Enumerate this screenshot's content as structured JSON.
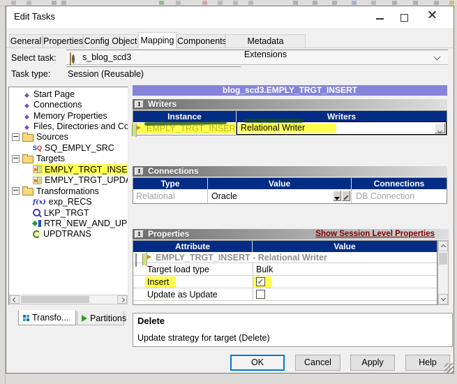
{
  "window": {
    "title": "Edit Tasks"
  },
  "tabs": {
    "active": "Mapping",
    "items": [
      {
        "label": "General"
      },
      {
        "label": "Properties"
      },
      {
        "label": "Config Object"
      },
      {
        "label": "Mapping"
      },
      {
        "label": "Components"
      },
      {
        "label": "Metadata Extensions"
      }
    ]
  },
  "task_form": {
    "select_task_label": "Select task:",
    "select_task_value": "s_blog_scd3",
    "task_type_label": "Task type:",
    "task_type_value": "Session (Reusable)"
  },
  "tree": {
    "items": [
      {
        "label": "Start Page",
        "icon": "navigation-diamond-icon"
      },
      {
        "label": "Connections",
        "icon": "navigation-diamond-icon"
      },
      {
        "label": "Memory Properties",
        "icon": "navigation-diamond-icon"
      },
      {
        "label": "Files, Directories and Com",
        "icon": "navigation-diamond-icon"
      },
      {
        "label": "Sources",
        "icon": "folder-icon",
        "expanded": true
      },
      {
        "label": "SQ_EMPLY_SRC",
        "icon": "source-qualifier-icon"
      },
      {
        "label": "Targets",
        "icon": "folder-icon",
        "expanded": true
      },
      {
        "label": "EMPLY_TRGT_INSERT",
        "icon": "target-icon",
        "highlighted": true
      },
      {
        "label": "EMPLY_TRGT_UPDATI",
        "icon": "target-icon"
      },
      {
        "label": "Transformations",
        "icon": "folder-icon",
        "expanded": true
      },
      {
        "label": "exp_RECS",
        "icon": "expression-icon"
      },
      {
        "label": "LKP_TRGT",
        "icon": "lookup-icon"
      },
      {
        "label": "RTR_NEW_AND_UPD.",
        "icon": "router-icon"
      },
      {
        "label": "UPDTRANS",
        "icon": "update-strategy-icon"
      }
    ]
  },
  "main": {
    "title": "blog_scd3.EMPLY_TRGT_INSERT",
    "writers": {
      "label": "Writers",
      "columns": [
        "Instance",
        "Writers"
      ],
      "row": {
        "instance": "EMPLY_TRGT_INSERT",
        "writer": "Relational Writer"
      }
    },
    "connections": {
      "label": "Connections",
      "columns": [
        "Type",
        "Value",
        "Connections"
      ],
      "row": {
        "type": "Relational",
        "value": "Oracle",
        "connection": "DB Connection"
      }
    },
    "properties": {
      "label": "Properties",
      "link": "Show Session Level Properties",
      "columns": [
        "Attribute",
        "Value"
      ],
      "group": "EMPLY_TRGT_INSERT - Relational Writer",
      "rows": [
        {
          "attribute": "Target load type",
          "value": "Bulk"
        },
        {
          "attribute": "Insert",
          "check": "✓",
          "highlighted": true
        },
        {
          "attribute": "Update as Update",
          "check": ""
        }
      ]
    },
    "description": {
      "title": "Delete",
      "text": "Update strategy for target (Delete)"
    }
  },
  "bottom_tabs": {
    "items": [
      {
        "label": "Transfo..."
      },
      {
        "label": "Partitions"
      }
    ]
  },
  "actions": {
    "items": [
      {
        "label": "OK"
      },
      {
        "label": "Cancel"
      },
      {
        "label": "Apply"
      },
      {
        "label": "Help"
      }
    ]
  },
  "colors": {
    "highlight_yellow": "#ffff4e",
    "grid_header_navy": "#032c85",
    "panel_title_purple": "#8684da",
    "link_dark_red": "#7b0000"
  }
}
